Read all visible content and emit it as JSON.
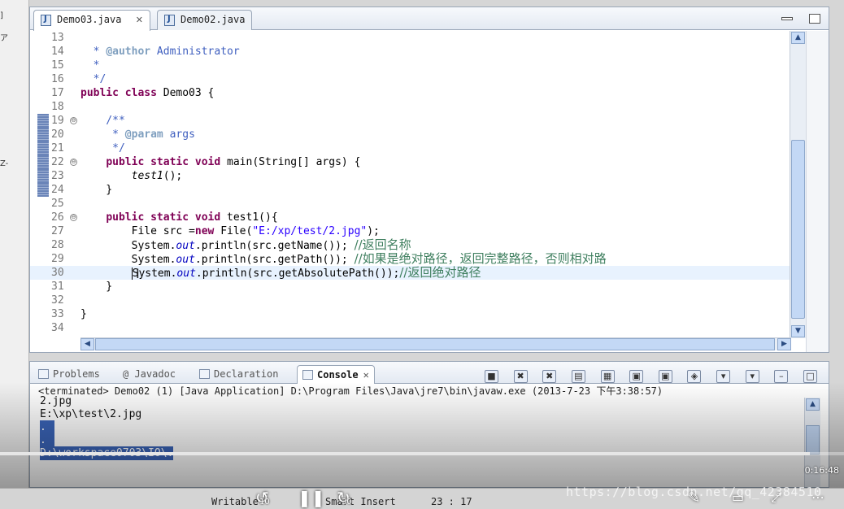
{
  "left_strip": {
    "marks": [
      "]",
      "ア",
      "Z-"
    ]
  },
  "editor": {
    "tabs": [
      {
        "label": "Demo03.java",
        "active": true,
        "close": "✕"
      },
      {
        "label": "Demo02.java",
        "active": false
      }
    ],
    "lines": [
      {
        "n": "13",
        "text": "   "
      },
      {
        "n": "14",
        "text": "  * @author Administrator"
      },
      {
        "n": "15",
        "text": "  *"
      },
      {
        "n": "16",
        "text": "  */"
      },
      {
        "n": "17",
        "text": "public class Demo03 {"
      },
      {
        "n": "18",
        "text": ""
      },
      {
        "n": "19",
        "text": "    /**"
      },
      {
        "n": "20",
        "text": "     * @param args"
      },
      {
        "n": "21",
        "text": "     */"
      },
      {
        "n": "22",
        "text": "    public static void main(String[] args) {"
      },
      {
        "n": "23",
        "text": "        test1();"
      },
      {
        "n": "24",
        "text": "    }"
      },
      {
        "n": "25",
        "text": ""
      },
      {
        "n": "26",
        "text": "    public static void test1(){"
      },
      {
        "n": "27",
        "text": "        File src =new File(\"E:/xp/test/2.jpg\");"
      },
      {
        "n": "28",
        "text": "        System.out.println(src.getName()); //返回名称"
      },
      {
        "n": "29",
        "text": "        System.out.println(src.getPath()); //如果是绝对路径，返回完整路径，否则相对路"
      },
      {
        "n": "30",
        "text": "        System.out.println(src.getAbsolutePath());//返回绝对路径"
      },
      {
        "n": "31",
        "text": "    }"
      },
      {
        "n": "32",
        "text": ""
      },
      {
        "n": "33",
        "text": "}"
      },
      {
        "n": "34",
        "text": ""
      }
    ],
    "code_parts": {
      "l14_star": "  * ",
      "l14_tag": "@author",
      "l14_rest": " Administrator",
      "l15": "  *",
      "l16": "  */",
      "l17_kw": "public class",
      "l17_rest": " Demo03 {",
      "l19": "    /**",
      "l20_star": "     * ",
      "l20_tag": "@param",
      "l20_rest": " args",
      "l21": "     */",
      "l22_kw": "public static void",
      "l22_rest": " main(String[] args) {",
      "l23_call": "test1",
      "l23_rest": "();",
      "l24": "    }",
      "l26_kw": "public static void",
      "l26_rest": " test1(){",
      "l27_a": "        File src =",
      "l27_kw": "new",
      "l27_b": " File(",
      "l27_str": "\"E:/xp/test/2.jpg\"",
      "l27_c": ");",
      "sys": "System.",
      "out": "out",
      "l28_mid": ".println(src.getName()); ",
      "l28_cm": "//返回名称",
      "l29_mid": ".println(src.getPath()); ",
      "l29_cm": "//如果是绝对路径，返回完整路径，否则相对路",
      "l30_mid": ".println(src.getAbsolutePath());",
      "l30_cm": "//返回绝对路径",
      "l31": "    }",
      "l33": "}"
    },
    "fold_symbol": "⊖"
  },
  "panel": {
    "tabs": [
      {
        "label": "Problems"
      },
      {
        "label": "@ Javadoc"
      },
      {
        "label": "Declaration"
      },
      {
        "label": "Console",
        "active": true,
        "close": "✕"
      }
    ],
    "header": "<terminated> Demo02 (1) [Java Application] D:\\Program Files\\Java\\jre7\\bin\\javaw.exe (2013-7-23 下午3:38:57)",
    "output": [
      "2.jpg",
      "E:\\xp\\test\\2.jpg",
      ".",
      ".",
      "D:\\workspace0703\\IO\\."
    ]
  },
  "video": {
    "time": "0:16:48",
    "progress": 0.96,
    "skip_back": "10",
    "skip_fwd": "30"
  },
  "status": {
    "writable": "Writable",
    "smart_insert": "Smart Insert",
    "position": "23 : 17"
  },
  "watermark": "https://blog.csdn.net/qq_42384510",
  "colors": {
    "keyword": "#7f0055",
    "comment": "#3f5fbf",
    "string": "#2a00ff",
    "line_comment": "#3f7f5f",
    "selection": "#3a64b8"
  }
}
